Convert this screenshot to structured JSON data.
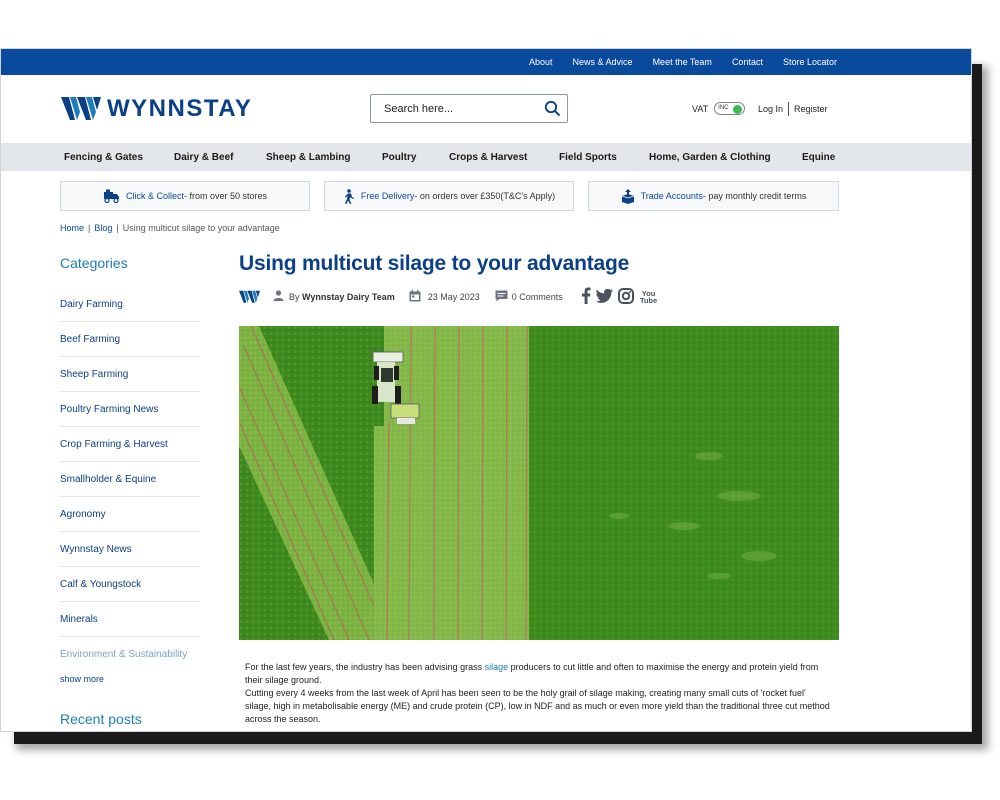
{
  "topnav": [
    "About",
    "News & Advice",
    "Meet the Team",
    "Contact",
    "Store Locator"
  ],
  "brand": {
    "name": "WYNNSTAY"
  },
  "search": {
    "placeholder": "Search here..."
  },
  "vat": {
    "label": "VAT",
    "toggle_text": "INC"
  },
  "account": {
    "login": "Log In",
    "register": "Register"
  },
  "mainnav": [
    "Fencing & Gates",
    "Dairy & Beef",
    "Sheep & Lambing",
    "Poultry",
    "Crops & Harvest",
    "Field Sports",
    "Home, Garden & Clothing",
    "Equine"
  ],
  "benefits": [
    {
      "title": "Click & Collect",
      "text": "- from over 50 stores",
      "icon": "truck-icon"
    },
    {
      "title": "Free Delivery",
      "text": "- on orders over £350(T&C's Apply)",
      "icon": "delivery-person-icon"
    },
    {
      "title": "Trade Accounts",
      "text": "- pay monthly credit terms",
      "icon": "trade-box-icon"
    }
  ],
  "breadcrumb": {
    "home": "Home",
    "blog": "Blog",
    "current": "Using multicut silage to your advantage"
  },
  "sidebar": {
    "title": "Categories",
    "items": [
      "Dairy Farming",
      "Beef Farming",
      "Sheep Farming",
      "Poultry Farming News",
      "Crop Farming & Harvest",
      "Smallholder & Equine",
      "Agronomy",
      "Wynnstay News",
      "Calf & Youngstock",
      "Minerals",
      "Environment & Sustainability"
    ],
    "show_more": "show more",
    "recent_title": "Recent posts"
  },
  "article": {
    "title": "Using multicut silage to your advantage",
    "author_prefix": "By",
    "author": "Wynnstay Dairy Team",
    "date": "23 May 2023",
    "comments": "0 Comments",
    "social": [
      "facebook-icon",
      "twitter-icon",
      "instagram-icon",
      "youtube-icon"
    ],
    "youtube_text_top": "You",
    "youtube_text_bottom": "Tube",
    "p1_before": "For the last few years, the industry has been advising grass ",
    "p1_link": "silage",
    "p1_after": " producers to cut little and often to maximise the energy and protein yield from their silage ground.",
    "p2": "Cutting every 4 weeks from the last week of April has been seen to be the holy grail of silage making, creating many small cuts of 'rocket fuel' silage, high in metabolisable energy (ME) and crude protein (CP), low in NDF and as much or even more yield than the traditional three cut method across the season."
  },
  "colors": {
    "brand_blue": "#0a4a9c",
    "link_blue": "#1e7db8",
    "nav_grey": "#e3e6ea",
    "toggle_green": "#3dbb4e"
  }
}
